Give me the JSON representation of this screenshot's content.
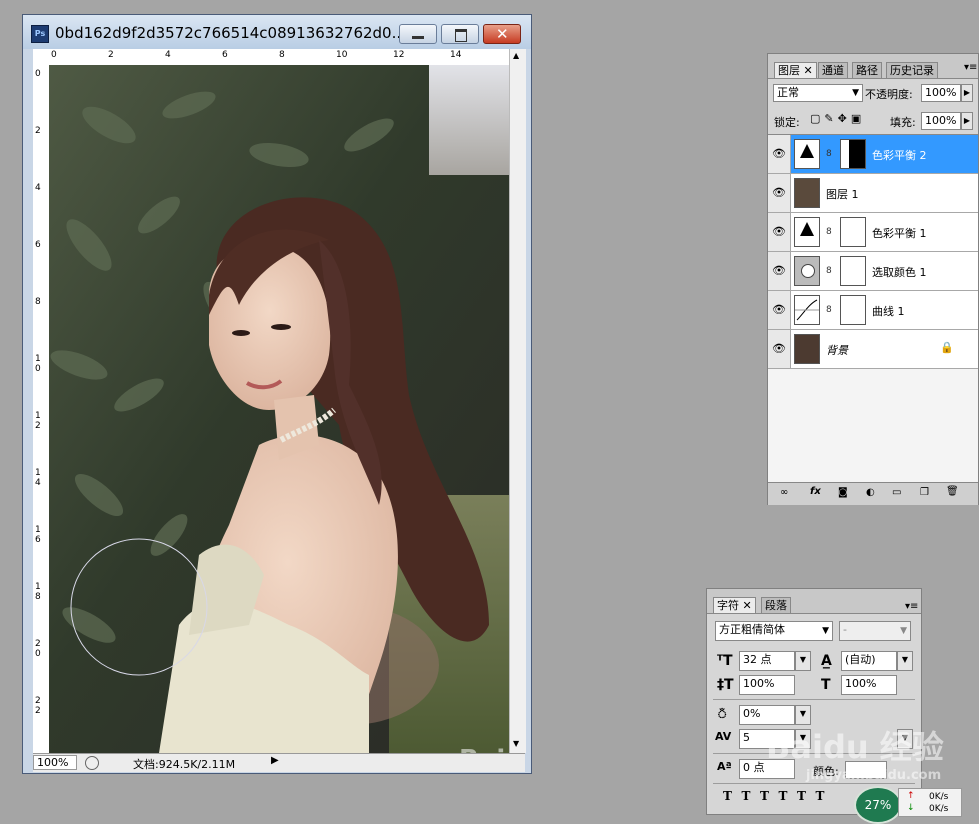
{
  "document": {
    "title": "0bd162d9f2d3572c766514c08913632762d0...",
    "ruler_top_labels": [
      "0",
      "2",
      "4",
      "6",
      "8",
      "10",
      "12",
      "14"
    ],
    "ruler_left_labels": [
      "0",
      "2",
      "4",
      "6",
      "8",
      "10",
      "12",
      "14",
      "16",
      "18",
      "20",
      "22"
    ],
    "zoom": "100%",
    "doc_info": "文档:924.5K/2.11M"
  },
  "layers_panel": {
    "tabs": [
      "图层",
      "通道",
      "路径",
      "历史记录"
    ],
    "blend_mode": "正常",
    "opacity_label": "不透明度:",
    "opacity_value": "100%",
    "lock_label": "锁定:",
    "fill_label": "填充:",
    "fill_value": "100%",
    "layers": [
      {
        "name": "色彩平衡 2",
        "selected": true
      },
      {
        "name": "图层 1",
        "selected": false
      },
      {
        "name": "色彩平衡 1",
        "selected": false
      },
      {
        "name": "选取颜色 1",
        "selected": false
      },
      {
        "name": "曲线 1",
        "selected": false
      },
      {
        "name": "背景",
        "selected": false
      }
    ],
    "footer_icons": [
      "link-icon",
      "fx-icon",
      "mask-icon",
      "adjustment-icon",
      "folder-icon",
      "new-layer-icon",
      "trash-icon"
    ]
  },
  "character_panel": {
    "tabs": [
      "字符",
      "段落"
    ],
    "font_family": "方正粗倩简体",
    "font_style": "-",
    "font_size": "32 点",
    "leading": "(自动)",
    "vertical_scale": "100%",
    "horizontal_scale": "100%",
    "tsume": "0%",
    "tracking": "5",
    "baseline_shift": "0 点",
    "color_label": "颜色:"
  },
  "net_widget": {
    "percent": "27%",
    "up": "0K/s",
    "down": "0K/s"
  },
  "watermark": {
    "text": "Baidu 经验",
    "url": "jingyan.baidu.com"
  },
  "colors": {
    "selected_layer": "#3399ff",
    "app_background": "#a5a5a5",
    "close_button": "#c63b22"
  }
}
